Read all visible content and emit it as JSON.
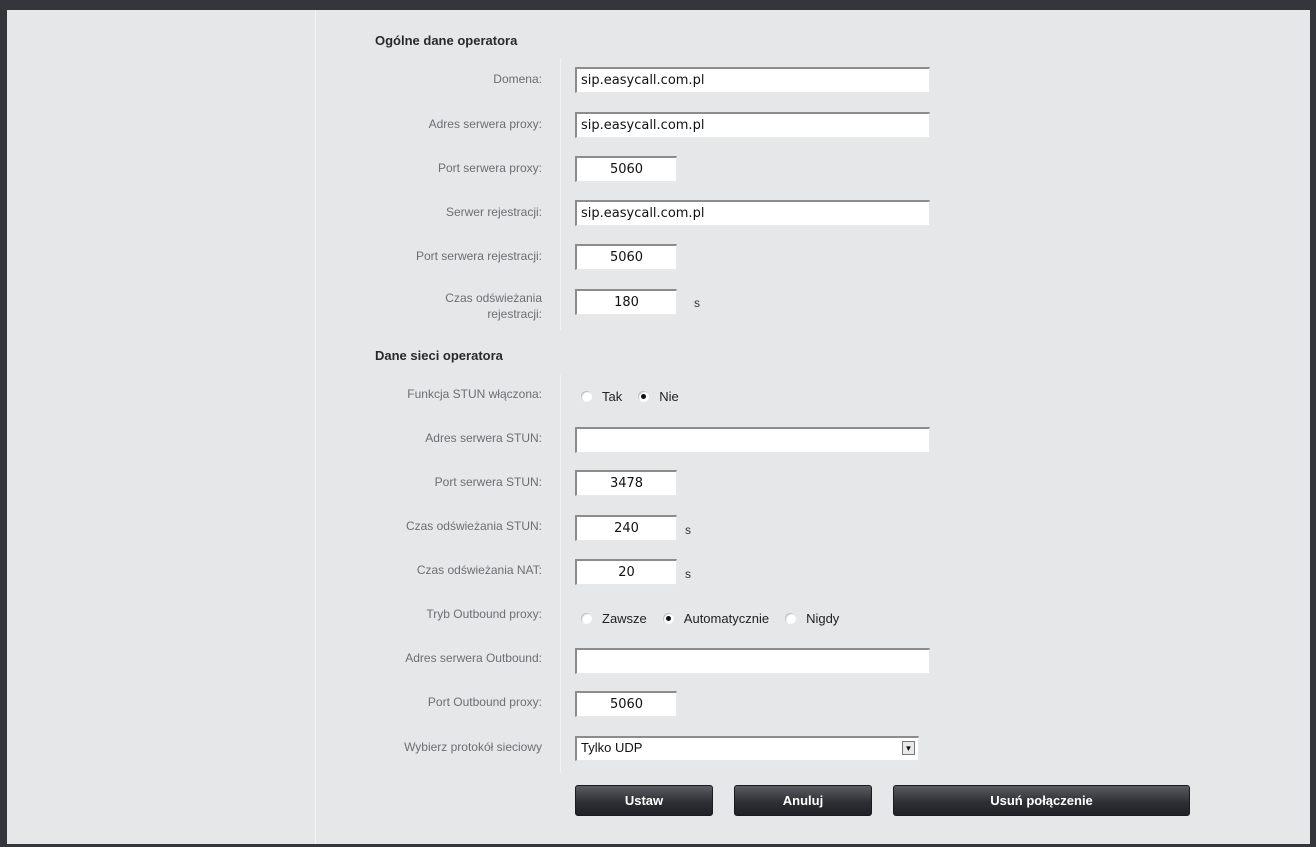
{
  "sections": {
    "general_title": "Ogólne dane operatora",
    "network_title": "Dane sieci operatora"
  },
  "fields": {
    "domain": {
      "label": "Domena:",
      "value": "sip.easycall.com.pl"
    },
    "proxy_address": {
      "label": "Adres serwera proxy:",
      "value": "sip.easycall.com.pl"
    },
    "proxy_port": {
      "label": "Port serwera proxy:",
      "value": "5060"
    },
    "registrar": {
      "label": "Serwer rejestracji:",
      "value": "sip.easycall.com.pl"
    },
    "registrar_port": {
      "label": "Port serwera rejestracji:",
      "value": "5060"
    },
    "registration_refresh": {
      "label_line1": "Czas odświeżania",
      "label_line2": "rejestracji:",
      "value": "180",
      "unit": "s"
    },
    "stun_enabled": {
      "label": "Funkcja STUN włączona:",
      "options": [
        "Tak",
        "Nie"
      ],
      "selected": "Nie"
    },
    "stun_address": {
      "label": "Adres serwera STUN:",
      "value": ""
    },
    "stun_port": {
      "label": "Port serwera STUN:",
      "value": "3478"
    },
    "stun_refresh": {
      "label": "Czas odświeżania STUN:",
      "value": "240",
      "unit": "s"
    },
    "nat_refresh": {
      "label": "Czas odświeżania NAT:",
      "value": "20",
      "unit": "s"
    },
    "outbound_mode": {
      "label": "Tryb Outbound proxy:",
      "options": [
        "Zawsze",
        "Automatycznie",
        "Nigdy"
      ],
      "selected": "Automatycznie"
    },
    "outbound_address": {
      "label": "Adres serwera Outbound:",
      "value": ""
    },
    "outbound_port": {
      "label": "Port Outbound proxy:",
      "value": "5060"
    },
    "protocol": {
      "label": "Wybierz protokół sieciowy",
      "selected": "Tylko UDP"
    }
  },
  "buttons": {
    "set": "Ustaw",
    "cancel": "Anuluj",
    "delete_connection": "Usuń połączenie"
  }
}
